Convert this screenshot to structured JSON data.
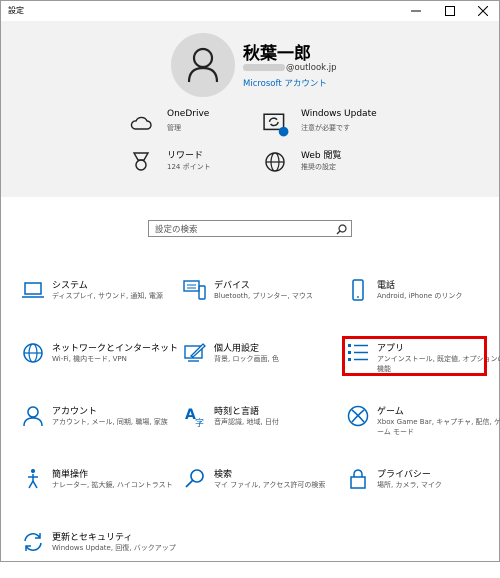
{
  "window": {
    "title": "設定"
  },
  "account": {
    "name": "秋葉一郎",
    "email_suffix": "@outlook.jp",
    "account_link": "Microsoft アカウント"
  },
  "quick": [
    {
      "title": "OneDrive",
      "sub": "管理",
      "icon": "cloud-icon"
    },
    {
      "title": "Windows Update",
      "sub": "注意が必要です",
      "icon": "windows-update-icon"
    },
    {
      "title": "リワード",
      "sub": "124 ポイント",
      "icon": "medal-icon"
    },
    {
      "title": "Web 閲覧",
      "sub": "推奨の設定",
      "icon": "globe-icon"
    }
  ],
  "search": {
    "placeholder": "設定の検索"
  },
  "categories": [
    {
      "title": "システム",
      "sub": "ディスプレイ, サウンド, 通知, 電源",
      "icon": "laptop-icon"
    },
    {
      "title": "デバイス",
      "sub": "Bluetooth, プリンター, マウス",
      "icon": "devices-icon"
    },
    {
      "title": "電話",
      "sub": "Android, iPhone のリンク",
      "icon": "phone-icon"
    },
    {
      "title": "ネットワークとインターネット",
      "sub": "Wi-Fi, 機内モード, VPN",
      "icon": "globe-network-icon"
    },
    {
      "title": "個人用設定",
      "sub": "背景, ロック画面, 色",
      "icon": "personalization-icon"
    },
    {
      "title": "アプリ",
      "sub": "アンインストール, 既定値, オプションの機能",
      "icon": "apps-list-icon"
    },
    {
      "title": "アカウント",
      "sub": "アカウント, メール, 同期, 職場, 家族",
      "icon": "person-icon"
    },
    {
      "title": "時刻と言語",
      "sub": "音声認識, 地域, 日付",
      "icon": "time-language-icon"
    },
    {
      "title": "ゲーム",
      "sub": "Xbox Game Bar, キャプチャ, 配信, ゲーム モード",
      "icon": "xbox-icon"
    },
    {
      "title": "簡単操作",
      "sub": "ナレーター, 拡大鏡, ハイコントラスト",
      "icon": "accessibility-icon"
    },
    {
      "title": "検索",
      "sub": "マイ ファイル, アクセス許可の検索",
      "icon": "search-icon"
    },
    {
      "title": "プライバシー",
      "sub": "場所, カメラ, マイク",
      "icon": "lock-icon"
    },
    {
      "title": "更新とセキュリティ",
      "sub": "Windows Update, 回復, バックアップ",
      "icon": "refresh-icon"
    }
  ],
  "colors": {
    "accent": "#0067c0",
    "highlight": "#e00000",
    "header_bg": "#f2f2f2"
  }
}
